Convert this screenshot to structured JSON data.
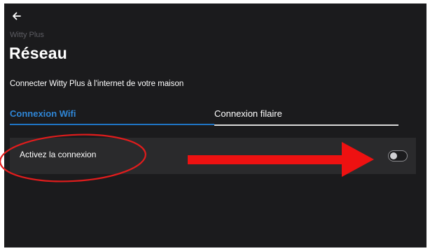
{
  "header": {
    "back_icon": "arrow-left-icon",
    "app_name": "Witty Plus",
    "title": "Réseau",
    "subtitle": "Connecter Witty Plus à l'internet de votre maison"
  },
  "tabs": [
    {
      "label": "Connexion Wifi",
      "active": true
    },
    {
      "label": "Connexion filaire",
      "active": false
    }
  ],
  "setting": {
    "label": "Activez la connexion",
    "enabled": false
  },
  "colors": {
    "background": "#1b1b1d",
    "row_background": "#2a2a2c",
    "accent": "#2f86d6",
    "annotation": "#e21c1c"
  }
}
